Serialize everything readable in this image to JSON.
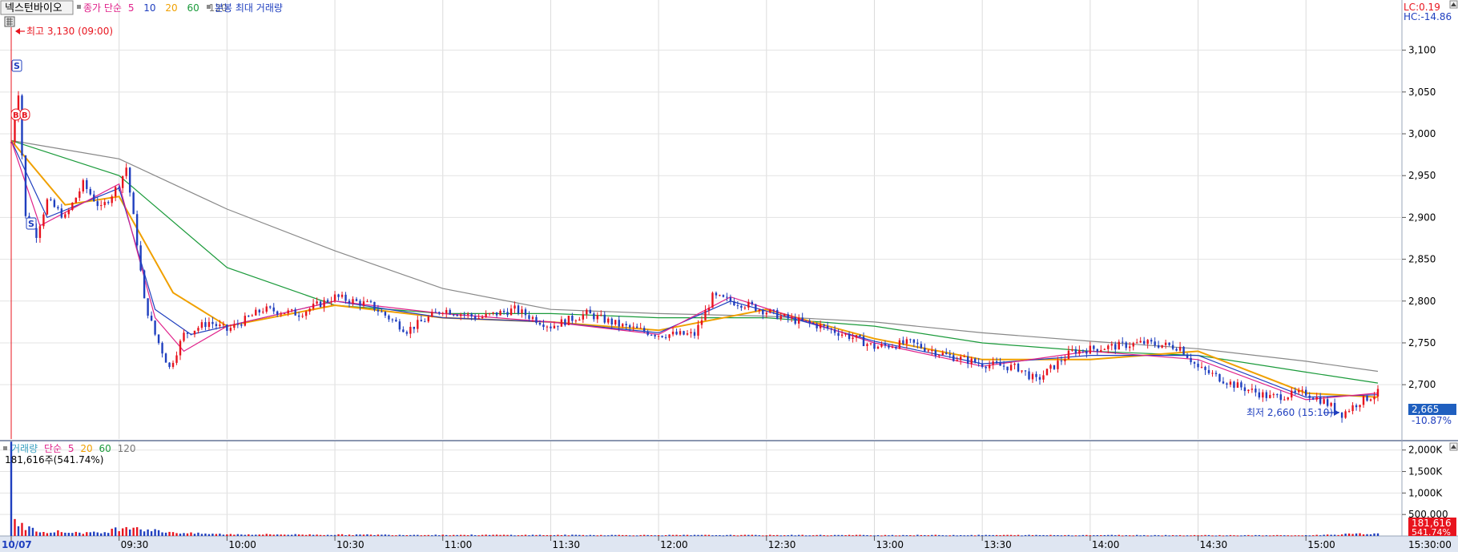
{
  "app": {
    "stock_name": "넥스턴바이오",
    "price_legend": [
      {
        "text": "종가 단순",
        "color": "#e0218a"
      },
      {
        "text": "5",
        "color": "#e0218a"
      },
      {
        "text": "10",
        "color": "#1f3fbf"
      },
      {
        "text": "20",
        "color": "#f0a000"
      },
      {
        "text": "60",
        "color": "#1a9a3a"
      },
      {
        "text": "120",
        "color": "#777777"
      }
    ],
    "price_legend_extra": "분봉 최대 거래량",
    "price_legend_extra_color": "#1f3fbf",
    "lc_label": "LC:0.19",
    "hc_label": "HC:-14.86",
    "volume_legend": [
      {
        "text": "거래량",
        "color": "#3aa0c0"
      },
      {
        "text": "단순",
        "color": "#e0218a"
      },
      {
        "text": "5",
        "color": "#e0218a"
      },
      {
        "text": "20",
        "color": "#f0a000"
      },
      {
        "text": "60",
        "color": "#1a9a3a"
      },
      {
        "text": "120",
        "color": "#777777"
      }
    ],
    "volume_readout": "181,616주(541.74%)"
  },
  "annotations": {
    "high": "최고 3,130 (09:00)",
    "low": "최저 2,660 (15:10)",
    "sell_marker": "S",
    "buy_marker": "B"
  },
  "price_badge": {
    "value": "2,665",
    "change": "-10.87%"
  },
  "volume_badge": {
    "value": "181,616",
    "ratio": "541.74%"
  },
  "time_box": "15:30:00",
  "colors": {
    "up": "#e8141e",
    "down": "#1f3fbf",
    "ma5": "#e0218a",
    "ma10": "#1f3fbf",
    "ma20": "#f0a000",
    "ma60": "#1a9a3a",
    "ma120": "#888888"
  },
  "chart_data": [
    {
      "type": "candlestick",
      "title": "넥스턴바이오",
      "x_ticks": [
        "10/07",
        "09:30",
        "10:00",
        "10:30",
        "11:00",
        "11:30",
        "12:00",
        "12:30",
        "13:00",
        "13:30",
        "14:00",
        "14:30",
        "15:00"
      ],
      "y_ticks": [
        "3,100",
        "3,050",
        "3,000",
        "2,950",
        "2,900",
        "2,850",
        "2,800",
        "2,750",
        "2,700"
      ],
      "ylim": [
        2635,
        3160
      ],
      "series_close": [
        {
          "t": "09:00",
          "v": 2990
        },
        {
          "t": "09:02",
          "v": 3050
        },
        {
          "t": "09:04",
          "v": 2900
        },
        {
          "t": "09:07",
          "v": 2880
        },
        {
          "t": "09:10",
          "v": 2920
        },
        {
          "t": "09:15",
          "v": 2900
        },
        {
          "t": "09:20",
          "v": 2940
        },
        {
          "t": "09:25",
          "v": 2910
        },
        {
          "t": "09:30",
          "v": 2940
        },
        {
          "t": "09:32",
          "v": 2960
        },
        {
          "t": "09:35",
          "v": 2870
        },
        {
          "t": "09:37",
          "v": 2800
        },
        {
          "t": "09:40",
          "v": 2760
        },
        {
          "t": "09:44",
          "v": 2720
        },
        {
          "t": "09:48",
          "v": 2760
        },
        {
          "t": "09:55",
          "v": 2775
        },
        {
          "t": "10:00",
          "v": 2765
        },
        {
          "t": "10:10",
          "v": 2790
        },
        {
          "t": "10:20",
          "v": 2785
        },
        {
          "t": "10:25",
          "v": 2795
        },
        {
          "t": "10:30",
          "v": 2805
        },
        {
          "t": "10:40",
          "v": 2795
        },
        {
          "t": "10:50",
          "v": 2765
        },
        {
          "t": "11:00",
          "v": 2790
        },
        {
          "t": "11:10",
          "v": 2780
        },
        {
          "t": "11:20",
          "v": 2790
        },
        {
          "t": "11:30",
          "v": 2770
        },
        {
          "t": "11:40",
          "v": 2785
        },
        {
          "t": "11:50",
          "v": 2770
        },
        {
          "t": "12:00",
          "v": 2760
        },
        {
          "t": "12:10",
          "v": 2760
        },
        {
          "t": "12:15",
          "v": 2805
        },
        {
          "t": "12:25",
          "v": 2795
        },
        {
          "t": "12:35",
          "v": 2780
        },
        {
          "t": "12:45",
          "v": 2770
        },
        {
          "t": "12:55",
          "v": 2755
        },
        {
          "t": "13:00",
          "v": 2745
        },
        {
          "t": "13:10",
          "v": 2750
        },
        {
          "t": "13:20",
          "v": 2735
        },
        {
          "t": "13:30",
          "v": 2725
        },
        {
          "t": "13:40",
          "v": 2720
        },
        {
          "t": "13:45",
          "v": 2705
        },
        {
          "t": "13:55",
          "v": 2740
        },
        {
          "t": "14:05",
          "v": 2745
        },
        {
          "t": "14:15",
          "v": 2750
        },
        {
          "t": "14:25",
          "v": 2745
        },
        {
          "t": "14:30",
          "v": 2720
        },
        {
          "t": "14:40",
          "v": 2700
        },
        {
          "t": "14:50",
          "v": 2685
        },
        {
          "t": "15:00",
          "v": 2690
        },
        {
          "t": "15:05",
          "v": 2680
        },
        {
          "t": "15:10",
          "v": 2665
        },
        {
          "t": "15:15",
          "v": 2680
        },
        {
          "t": "15:20",
          "v": 2690
        }
      ],
      "ma_series": [
        {
          "name": "120",
          "points": [
            {
              "t": "09:00",
              "v": 2992
            },
            {
              "t": "09:30",
              "v": 2970
            },
            {
              "t": "10:00",
              "v": 2910
            },
            {
              "t": "10:30",
              "v": 2860
            },
            {
              "t": "11:00",
              "v": 2815
            },
            {
              "t": "11:30",
              "v": 2790
            },
            {
              "t": "12:00",
              "v": 2785
            },
            {
              "t": "12:30",
              "v": 2782
            },
            {
              "t": "13:00",
              "v": 2775
            },
            {
              "t": "13:30",
              "v": 2762
            },
            {
              "t": "14:00",
              "v": 2752
            },
            {
              "t": "14:30",
              "v": 2743
            },
            {
              "t": "15:00",
              "v": 2728
            },
            {
              "t": "15:20",
              "v": 2716
            }
          ]
        },
        {
          "name": "60",
          "points": [
            {
              "t": "09:00",
              "v": 2992
            },
            {
              "t": "09:30",
              "v": 2950
            },
            {
              "t": "10:00",
              "v": 2840
            },
            {
              "t": "10:30",
              "v": 2795
            },
            {
              "t": "11:00",
              "v": 2785
            },
            {
              "t": "11:30",
              "v": 2785
            },
            {
              "t": "12:00",
              "v": 2780
            },
            {
              "t": "12:30",
              "v": 2780
            },
            {
              "t": "13:00",
              "v": 2770
            },
            {
              "t": "13:30",
              "v": 2750
            },
            {
              "t": "14:00",
              "v": 2740
            },
            {
              "t": "14:30",
              "v": 2735
            },
            {
              "t": "15:00",
              "v": 2715
            },
            {
              "t": "15:20",
              "v": 2702
            }
          ]
        },
        {
          "name": "20",
          "points": [
            {
              "t": "09:00",
              "v": 2992
            },
            {
              "t": "09:15",
              "v": 2915
            },
            {
              "t": "09:30",
              "v": 2925
            },
            {
              "t": "09:45",
              "v": 2810
            },
            {
              "t": "10:00",
              "v": 2770
            },
            {
              "t": "10:30",
              "v": 2795
            },
            {
              "t": "11:00",
              "v": 2780
            },
            {
              "t": "11:30",
              "v": 2775
            },
            {
              "t": "12:00",
              "v": 2765
            },
            {
              "t": "12:30",
              "v": 2790
            },
            {
              "t": "13:00",
              "v": 2755
            },
            {
              "t": "13:30",
              "v": 2730
            },
            {
              "t": "14:00",
              "v": 2730
            },
            {
              "t": "14:30",
              "v": 2740
            },
            {
              "t": "15:00",
              "v": 2690
            },
            {
              "t": "15:20",
              "v": 2685
            }
          ]
        },
        {
          "name": "10",
          "points": [
            {
              "t": "09:00",
              "v": 2992
            },
            {
              "t": "09:10",
              "v": 2900
            },
            {
              "t": "09:30",
              "v": 2935
            },
            {
              "t": "09:40",
              "v": 2790
            },
            {
              "t": "09:50",
              "v": 2760
            },
            {
              "t": "10:00",
              "v": 2770
            },
            {
              "t": "10:30",
              "v": 2800
            },
            {
              "t": "11:00",
              "v": 2780
            },
            {
              "t": "11:30",
              "v": 2775
            },
            {
              "t": "12:00",
              "v": 2762
            },
            {
              "t": "12:20",
              "v": 2800
            },
            {
              "t": "13:00",
              "v": 2752
            },
            {
              "t": "13:30",
              "v": 2725
            },
            {
              "t": "14:00",
              "v": 2735
            },
            {
              "t": "14:30",
              "v": 2735
            },
            {
              "t": "15:00",
              "v": 2685
            },
            {
              "t": "15:20",
              "v": 2688
            }
          ]
        },
        {
          "name": "5",
          "points": [
            {
              "t": "09:00",
              "v": 2992
            },
            {
              "t": "09:08",
              "v": 2890
            },
            {
              "t": "09:30",
              "v": 2940
            },
            {
              "t": "09:40",
              "v": 2780
            },
            {
              "t": "09:48",
              "v": 2740
            },
            {
              "t": "10:00",
              "v": 2770
            },
            {
              "t": "10:30",
              "v": 2800
            },
            {
              "t": "11:00",
              "v": 2785
            },
            {
              "t": "11:30",
              "v": 2775
            },
            {
              "t": "12:00",
              "v": 2760
            },
            {
              "t": "12:20",
              "v": 2805
            },
            {
              "t": "13:00",
              "v": 2750
            },
            {
              "t": "13:30",
              "v": 2722
            },
            {
              "t": "14:00",
              "v": 2740
            },
            {
              "t": "14:30",
              "v": 2730
            },
            {
              "t": "15:00",
              "v": 2682
            },
            {
              "t": "15:20",
              "v": 2690
            }
          ]
        }
      ]
    },
    {
      "type": "bar",
      "title": "거래량",
      "y_ticks": [
        "2,000K",
        "1,500K",
        "1,000K",
        "500,000"
      ],
      "ylim": [
        0,
        2200000
      ],
      "bars": [
        {
          "t": "09:00",
          "v": 1900000
        },
        {
          "t": "09:01",
          "v": 400000
        },
        {
          "t": "09:02",
          "v": 300000
        },
        {
          "t": "09:04",
          "v": 200000
        },
        {
          "t": "09:06",
          "v": 150000
        },
        {
          "t": "09:10",
          "v": 110000
        },
        {
          "t": "09:15",
          "v": 90000
        },
        {
          "t": "09:20",
          "v": 80000
        },
        {
          "t": "09:25",
          "v": 70000
        },
        {
          "t": "09:33",
          "v": 250000
        },
        {
          "t": "09:36",
          "v": 180000
        },
        {
          "t": "09:40",
          "v": 120000
        },
        {
          "t": "09:45",
          "v": 90000
        },
        {
          "t": "09:50",
          "v": 60000
        },
        {
          "t": "10:00",
          "v": 40000
        },
        {
          "t": "10:30",
          "v": 30000
        },
        {
          "t": "11:00",
          "v": 25000
        },
        {
          "t": "12:00",
          "v": 20000
        },
        {
          "t": "13:00",
          "v": 20000
        },
        {
          "t": "14:00",
          "v": 20000
        },
        {
          "t": "15:00",
          "v": 15000
        },
        {
          "t": "15:20",
          "v": 60000
        }
      ]
    }
  ]
}
